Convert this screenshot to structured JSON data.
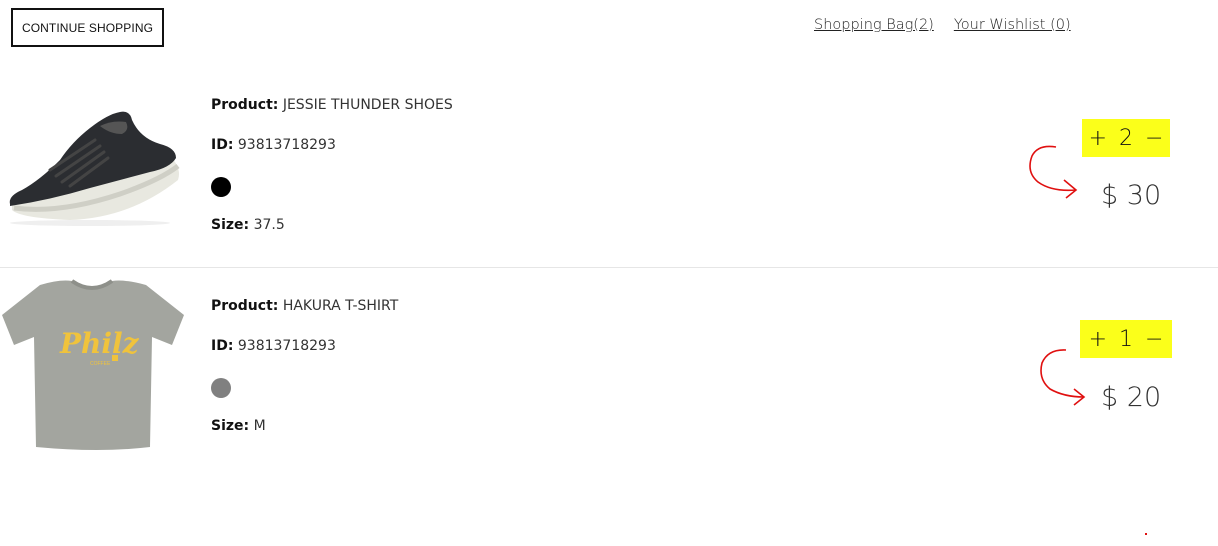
{
  "header": {
    "continue_label": "CONTINUE SHOPPING",
    "bag_link": "Shopping Bag(2)",
    "wishlist_link": "Your Wishlist (0)"
  },
  "labels": {
    "product": "Product:",
    "id": "ID:",
    "size": "Size:"
  },
  "items": [
    {
      "product": "JESSIE THUNDER SHOES",
      "id": "93813718293",
      "color": "#000000",
      "size": "37.5",
      "quantity": "2",
      "price": "$ 30",
      "image_icon": "shoe-image"
    },
    {
      "product": "HAKURA T-SHIRT",
      "id": "93813718293",
      "color": "#808080",
      "size": "M",
      "quantity": "1",
      "price": "$ 20",
      "image_icon": "tshirt-image",
      "shirt_brand": "Philz",
      "shirt_sub": "COFFEE"
    }
  ],
  "qty_controls": {
    "plus": "+",
    "minus": "−"
  },
  "colors": {
    "highlight": "#fbff1a",
    "annotation_arrow": "#e01010"
  }
}
